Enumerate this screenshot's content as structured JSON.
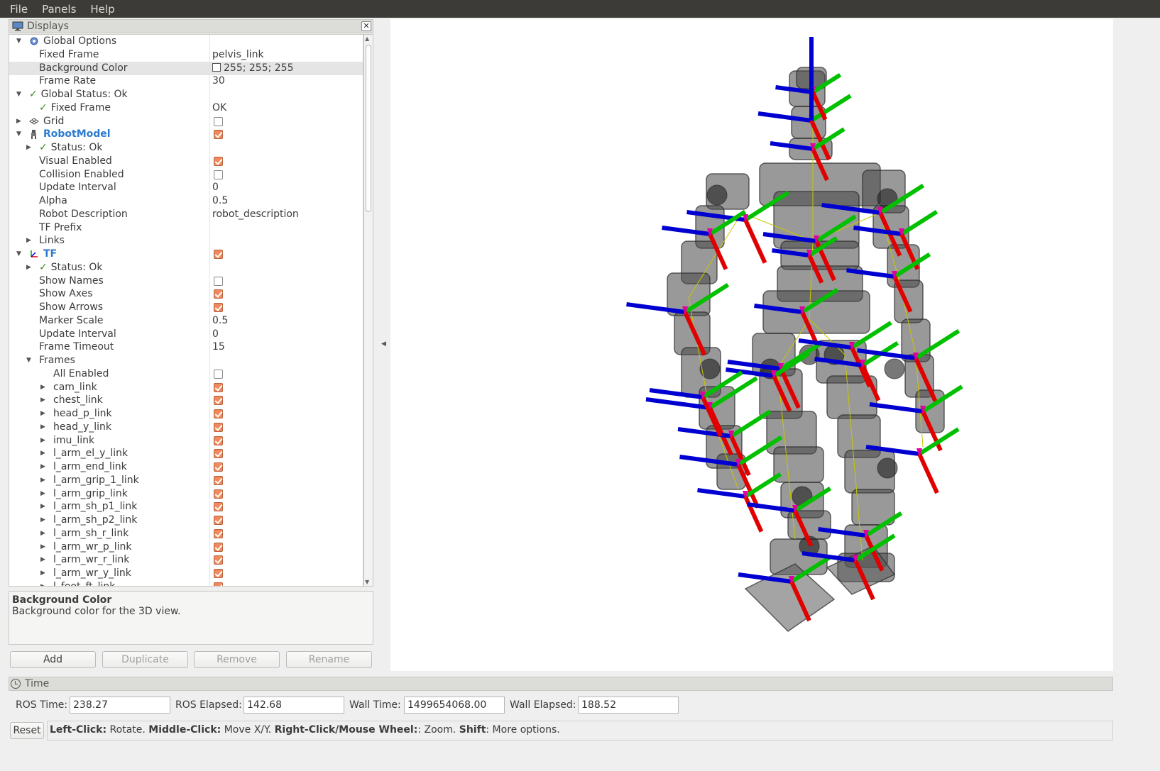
{
  "menu": {
    "file": "File",
    "panels": "Panels",
    "help": "Help"
  },
  "displays": {
    "title": "Displays",
    "rows": [
      {
        "indent": 0,
        "arrow": "down",
        "icon": "gear-icon",
        "label": "Global Options",
        "value": ""
      },
      {
        "indent": 1,
        "label": "Fixed Frame",
        "value": "pelvis_link"
      },
      {
        "indent": 1,
        "label": "Background Color",
        "value": "255; 255; 255",
        "swatch": true,
        "selected": true
      },
      {
        "indent": 1,
        "label": "Frame Rate",
        "value": "30"
      },
      {
        "indent": 0,
        "arrow": "down",
        "check": true,
        "label": "Global Status: Ok",
        "value": ""
      },
      {
        "indent": 1,
        "check": true,
        "label": "Fixed Frame",
        "value": "OK"
      },
      {
        "indent": 0,
        "arrow": "right",
        "icon": "grid-icon",
        "label": "Grid",
        "cb": "off"
      },
      {
        "indent": 0,
        "arrow": "down",
        "icon": "robot-icon",
        "label": "RobotModel",
        "blue": true,
        "cb": "on"
      },
      {
        "indent": 1,
        "arrow": "right",
        "check": true,
        "label": "Status: Ok",
        "value": ""
      },
      {
        "indent": 1,
        "label": "Visual Enabled",
        "cb": "on"
      },
      {
        "indent": 1,
        "label": "Collision Enabled",
        "cb": "off"
      },
      {
        "indent": 1,
        "label": "Update Interval",
        "value": "0"
      },
      {
        "indent": 1,
        "label": "Alpha",
        "value": "0.5"
      },
      {
        "indent": 1,
        "label": "Robot Description",
        "value": "robot_description"
      },
      {
        "indent": 1,
        "label": "TF Prefix",
        "value": ""
      },
      {
        "indent": 1,
        "arrow": "right",
        "label": "Links",
        "value": ""
      },
      {
        "indent": 0,
        "arrow": "down",
        "icon": "tf-icon",
        "label": "TF",
        "blue": true,
        "cb": "on"
      },
      {
        "indent": 1,
        "arrow": "right",
        "check": true,
        "label": "Status: Ok",
        "value": ""
      },
      {
        "indent": 1,
        "label": "Show Names",
        "cb": "off"
      },
      {
        "indent": 1,
        "label": "Show Axes",
        "cb": "on"
      },
      {
        "indent": 1,
        "label": "Show Arrows",
        "cb": "on"
      },
      {
        "indent": 1,
        "label": "Marker Scale",
        "value": "0.5"
      },
      {
        "indent": 1,
        "label": "Update Interval",
        "value": "0"
      },
      {
        "indent": 1,
        "label": "Frame Timeout",
        "value": "15"
      },
      {
        "indent": 1,
        "arrow": "down",
        "label": "Frames",
        "value": ""
      },
      {
        "indent": 2,
        "label": "All Enabled",
        "cb": "off"
      },
      {
        "indent": 2,
        "arrow": "right",
        "label": "cam_link",
        "cb": "on"
      },
      {
        "indent": 2,
        "arrow": "right",
        "label": "chest_link",
        "cb": "on"
      },
      {
        "indent": 2,
        "arrow": "right",
        "label": "head_p_link",
        "cb": "on"
      },
      {
        "indent": 2,
        "arrow": "right",
        "label": "head_y_link",
        "cb": "on"
      },
      {
        "indent": 2,
        "arrow": "right",
        "label": "imu_link",
        "cb": "on"
      },
      {
        "indent": 2,
        "arrow": "right",
        "label": "l_arm_el_y_link",
        "cb": "on"
      },
      {
        "indent": 2,
        "arrow": "right",
        "label": "l_arm_end_link",
        "cb": "on"
      },
      {
        "indent": 2,
        "arrow": "right",
        "label": "l_arm_grip_1_link",
        "cb": "on"
      },
      {
        "indent": 2,
        "arrow": "right",
        "label": "l_arm_grip_link",
        "cb": "on"
      },
      {
        "indent": 2,
        "arrow": "right",
        "label": "l_arm_sh_p1_link",
        "cb": "on"
      },
      {
        "indent": 2,
        "arrow": "right",
        "label": "l_arm_sh_p2_link",
        "cb": "on"
      },
      {
        "indent": 2,
        "arrow": "right",
        "label": "l_arm_sh_r_link",
        "cb": "on"
      },
      {
        "indent": 2,
        "arrow": "right",
        "label": "l_arm_wr_p_link",
        "cb": "on"
      },
      {
        "indent": 2,
        "arrow": "right",
        "label": "l_arm_wr_r_link",
        "cb": "on"
      },
      {
        "indent": 2,
        "arrow": "right",
        "label": "l_arm_wr_y_link",
        "cb": "on"
      },
      {
        "indent": 2,
        "arrow": "right",
        "label": "l_foot_ft_link",
        "cb": "on"
      }
    ]
  },
  "description": {
    "title": "Background Color",
    "text": "Background color for the 3D view."
  },
  "buttons": {
    "add": "Add",
    "duplicate": "Duplicate",
    "remove": "Remove",
    "rename": "Rename"
  },
  "time": {
    "title": "Time",
    "ros_time_label": "ROS Time:",
    "ros_time": "238.27",
    "ros_elapsed_label": "ROS Elapsed:",
    "ros_elapsed": "142.68",
    "wall_time_label": "Wall Time:",
    "wall_time": "1499654068.00",
    "wall_elapsed_label": "Wall Elapsed:",
    "wall_elapsed": "188.52"
  },
  "status": {
    "reset": "Reset",
    "left_click": "Left-Click:",
    "left_click_text": " Rotate. ",
    "middle_click": "Middle-Click:",
    "middle_click_text": " Move X/Y. ",
    "right_click": "Right-Click/Mouse Wheel:",
    "right_click_text": ": Zoom. ",
    "shift": "Shift",
    "shift_text": ": More options."
  },
  "colors": {
    "menubar": "#3c3b37",
    "checkbox_on": "#f08a5d",
    "axis_x": "#e00000",
    "axis_y": "#00c000",
    "axis_z": "#0000d0"
  }
}
